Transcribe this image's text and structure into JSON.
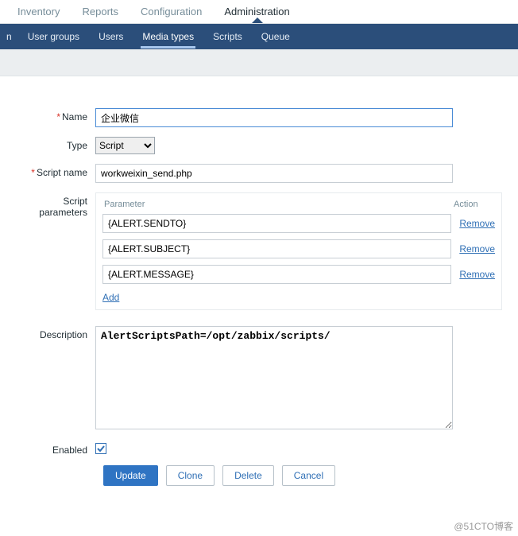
{
  "top_tabs": {
    "items": [
      "Inventory",
      "Reports",
      "Configuration",
      "Administration"
    ],
    "active_index": 3
  },
  "subnav": {
    "left_trunc": "n",
    "items": [
      "User groups",
      "Users",
      "Media types",
      "Scripts",
      "Queue"
    ],
    "active_index": 2
  },
  "form": {
    "name_label": "Name",
    "name_value": "企业微信",
    "type_label": "Type",
    "type_value": "Script",
    "scriptname_label": "Script name",
    "scriptname_value": "workweixin_send.php",
    "params_label": "Script parameters",
    "params_head_param": "Parameter",
    "params_head_action": "Action",
    "params": [
      {
        "value": "{ALERT.SENDTO}",
        "remove": "Remove"
      },
      {
        "value": "{ALERT.SUBJECT}",
        "remove": "Remove"
      },
      {
        "value": "{ALERT.MESSAGE}",
        "remove": "Remove"
      }
    ],
    "add_label": "Add",
    "desc_label": "Description",
    "desc_value": "AlertScriptsPath=/opt/zabbix/scripts/",
    "enabled_label": "Enabled",
    "enabled_checked": true
  },
  "buttons": {
    "update": "Update",
    "clone": "Clone",
    "delete": "Delete",
    "cancel": "Cancel"
  },
  "watermark": "@51CTO博客"
}
